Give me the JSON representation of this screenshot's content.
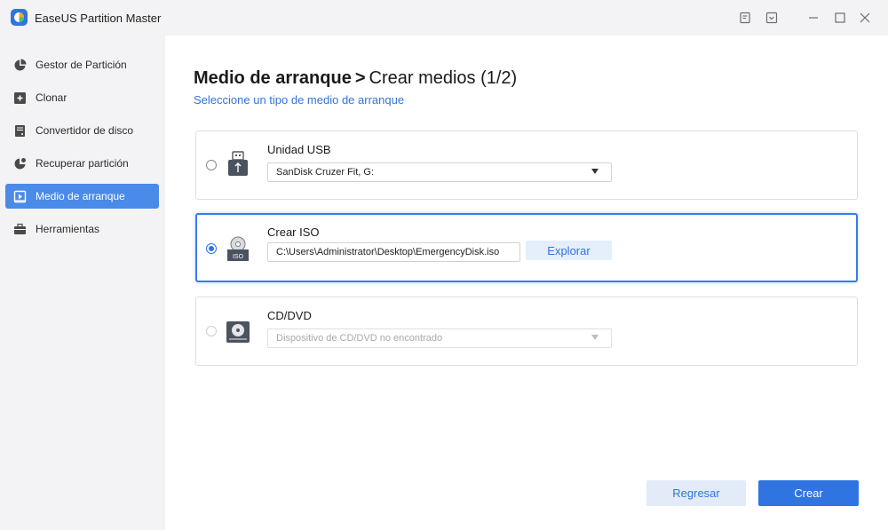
{
  "app": {
    "title": "EaseUS Partition Master"
  },
  "titlebar": {
    "icons": [
      "notes-icon",
      "download-icon",
      "minimize-icon",
      "maximize-icon",
      "close-icon"
    ]
  },
  "sidebar": {
    "items": [
      {
        "label": "Gestor de Partición",
        "icon": "pie-chart-icon",
        "active": false
      },
      {
        "label": "Clonar",
        "icon": "clone-icon",
        "active": false
      },
      {
        "label": "Convertidor de disco",
        "icon": "disk-icon",
        "active": false
      },
      {
        "label": "Recuperar partición",
        "icon": "pie-recover-icon",
        "active": false
      },
      {
        "label": "Medio de arranque",
        "icon": "boot-media-icon",
        "active": true
      },
      {
        "label": "Herramientas",
        "icon": "toolbox-icon",
        "active": false
      }
    ]
  },
  "main": {
    "title_bold": "Medio de arranque",
    "title_sep": ">",
    "title_rest": "Crear medios (1/2)",
    "subtitle": "Seleccione un tipo de medio de arranque",
    "options": [
      {
        "label": "Unidad USB",
        "value": "SanDisk Cruzer Fit, G:",
        "selected": false,
        "enabled": true,
        "icon": "usb-drive-icon"
      },
      {
        "label": "Crear ISO",
        "value": "C:\\Users\\Administrator\\Desktop\\EmergencyDisk.iso",
        "browse_label": "Explorar",
        "selected": true,
        "enabled": true,
        "icon": "iso-disc-icon"
      },
      {
        "label": "CD/DVD",
        "value": "Dispositivo de CD/DVD no encontrado",
        "selected": false,
        "enabled": false,
        "icon": "cd-drive-icon"
      }
    ]
  },
  "footer": {
    "back_label": "Regresar",
    "create_label": "Crear"
  },
  "colors": {
    "accent": "#2f74e0",
    "sidebar_bg": "#f3f3f5",
    "active_item": "#4a8ae8"
  }
}
